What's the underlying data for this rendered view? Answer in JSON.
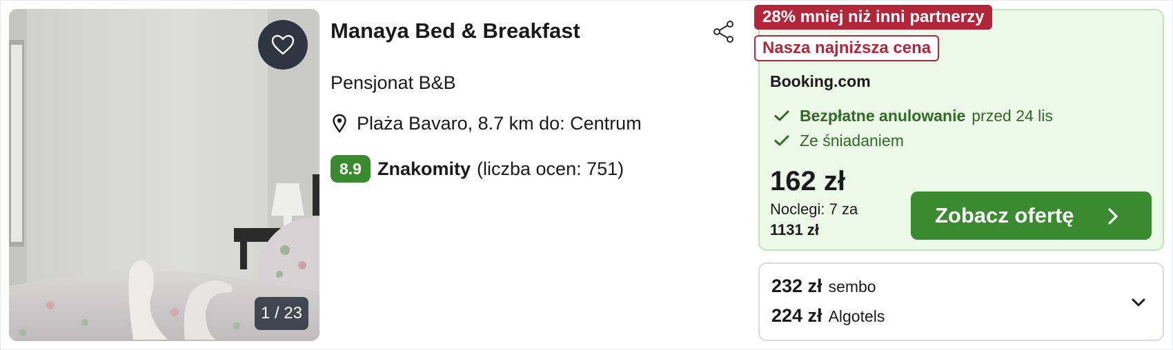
{
  "gallery": {
    "counter": "1 / 23",
    "favorite_icon": "heart-outline-icon"
  },
  "hotel": {
    "name": "Manaya Bed & Breakfast",
    "type": "Pensjonat B&B",
    "location": "Plaża Bavaro, 8.7 km do: Centrum",
    "rating_score": "8.9",
    "rating_label": "Znakomity",
    "rating_count": "(liczba ocen: 751)"
  },
  "main_offer": {
    "badge_discount": "28% mniej niż inni partnerzy",
    "badge_lowest": "Nasza najniższa cena",
    "provider": "Booking.com",
    "perks": [
      {
        "bold": "Bezpłatne anulowanie",
        "rest": "przed 24 lis"
      },
      {
        "bold": "",
        "rest": "Ze śniadaniem"
      }
    ],
    "price": "162 zł",
    "nights_text": "Noclegi: 7 za",
    "total": "1131 zł",
    "cta_label": "Zobacz ofertę"
  },
  "other_offers": [
    {
      "price": "232 zł",
      "partner": "sembo"
    },
    {
      "price": "224 zł",
      "partner": "Algotels"
    }
  ],
  "colors": {
    "accent_green": "#3a8a2f",
    "badge_red": "#b3263a",
    "offer_bg": "#ecf8e8",
    "perk_green": "#2f6b25"
  }
}
